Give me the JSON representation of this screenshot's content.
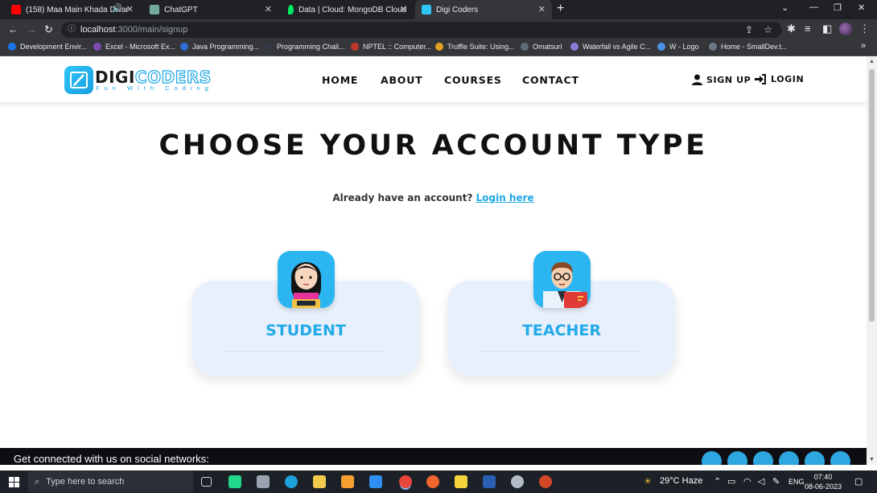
{
  "browser": {
    "tabs": [
      {
        "title": "(158) Maa Main Khada Dwar",
        "color": "#ff0000"
      },
      {
        "title": "ChatGPT",
        "color": "#74aa9c"
      },
      {
        "title": "Data | Cloud: MongoDB Cloud",
        "color": "#00ed64"
      },
      {
        "title": "Digi Coders",
        "color": "#2ec5f7"
      }
    ],
    "url_host": "localhost",
    "url_path": ":3000/main/signup",
    "bookmarks": [
      {
        "label": "Development Envir...",
        "color": "#1a73e8"
      },
      {
        "label": "Excel - Microsoft Ex...",
        "color": "#7b4bb5"
      },
      {
        "label": "Java Programming...",
        "color": "#2f6fd6"
      },
      {
        "label": "Programming Chall...",
        "color": "#333a44"
      },
      {
        "label": "NPTEL :: Computer...",
        "color": "#c0392b"
      },
      {
        "label": "Truffle Suite: Using...",
        "color": "#e0a020"
      },
      {
        "label": "Omatsuri",
        "color": "#5f6b7a"
      },
      {
        "label": "Waterfall vs Agile C...",
        "color": "#8a7ad8"
      },
      {
        "label": "W - Logo",
        "color": "#4a90e2"
      },
      {
        "label": "Home - SmallDev.t...",
        "color": "#6c7a89"
      }
    ],
    "more": "»"
  },
  "site": {
    "logo_main_a": "DIGI",
    "logo_main_b": "CODERS",
    "logo_tagline": "Fun With Coding",
    "nav": [
      "HOME",
      "ABOUT",
      "COURSES",
      "CONTACT"
    ],
    "signup": "SIGN UP",
    "login": "LOGIN",
    "title": "CHOOSE YOUR ACCOUNT TYPE",
    "already": "Already have an account?",
    "login_link": "Login here",
    "cards": [
      {
        "label": "STUDENT"
      },
      {
        "label": "TEACHER"
      }
    ],
    "footer_text": "Get connected with us on social networks:",
    "accent": "#22aae8"
  },
  "taskbar": {
    "search_placeholder": "Type here to search",
    "weather": "29°C  Haze",
    "lang": "ENG",
    "time": "07:40",
    "date": "08-06-2023"
  }
}
